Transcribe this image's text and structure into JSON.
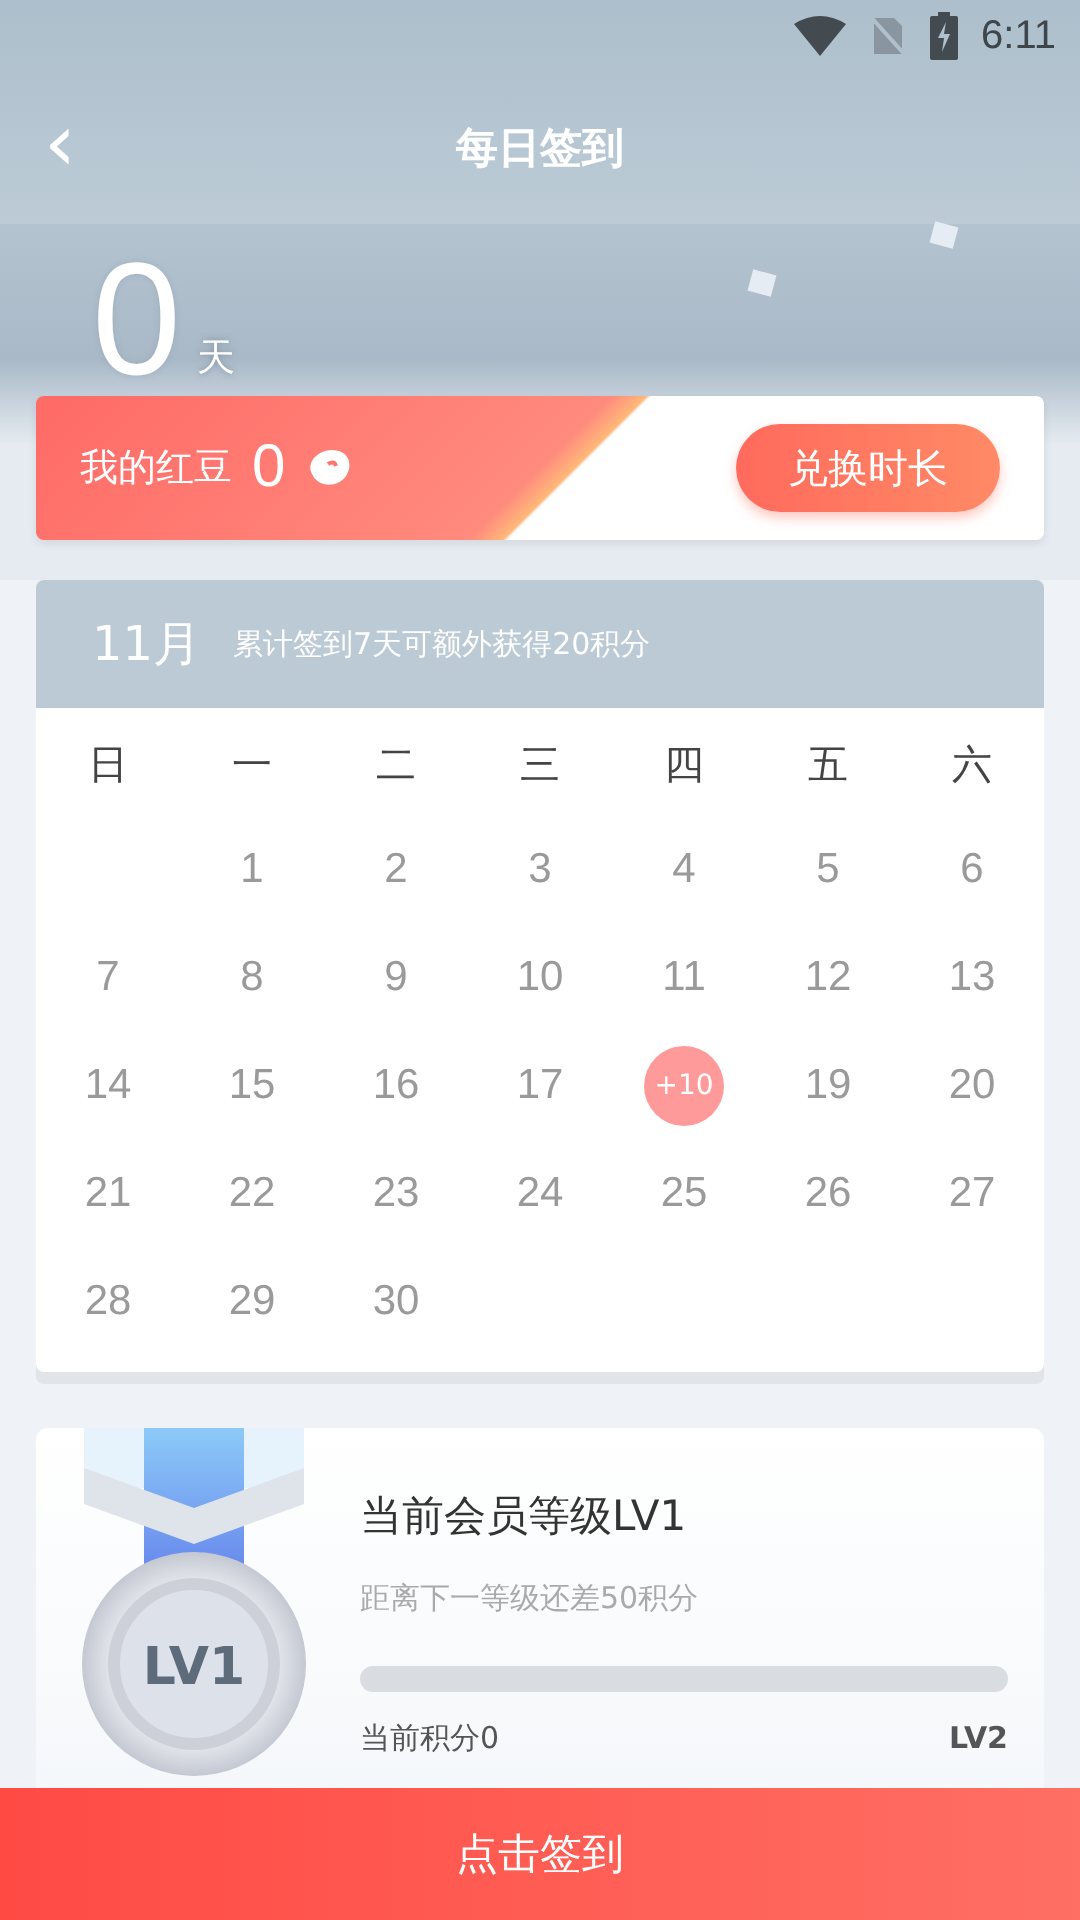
{
  "status_bar": {
    "time": "6:11"
  },
  "header": {
    "title": "每日签到",
    "back": "‹"
  },
  "streak": {
    "value": "0",
    "unit": "天"
  },
  "beans": {
    "label": "我的红豆",
    "count": "0",
    "button": "兑换时长"
  },
  "calendar": {
    "month": "11月",
    "note": "累计签到7天可额外获得20积分",
    "weekdays": [
      "日",
      "一",
      "二",
      "三",
      "四",
      "五",
      "六"
    ],
    "days": [
      {
        "kind": "empty"
      },
      {
        "kind": "day",
        "label": "1"
      },
      {
        "kind": "day",
        "label": "2"
      },
      {
        "kind": "day",
        "label": "3"
      },
      {
        "kind": "day",
        "label": "4"
      },
      {
        "kind": "day",
        "label": "5"
      },
      {
        "kind": "day",
        "label": "6"
      },
      {
        "kind": "day",
        "label": "7"
      },
      {
        "kind": "day",
        "label": "8"
      },
      {
        "kind": "day",
        "label": "9"
      },
      {
        "kind": "day",
        "label": "10"
      },
      {
        "kind": "day",
        "label": "11"
      },
      {
        "kind": "day",
        "label": "12"
      },
      {
        "kind": "day",
        "label": "13"
      },
      {
        "kind": "day",
        "label": "14"
      },
      {
        "kind": "day",
        "label": "15"
      },
      {
        "kind": "day",
        "label": "16"
      },
      {
        "kind": "day",
        "label": "17"
      },
      {
        "kind": "bonus",
        "label": "+10"
      },
      {
        "kind": "day",
        "label": "19"
      },
      {
        "kind": "day",
        "label": "20"
      },
      {
        "kind": "day",
        "label": "21"
      },
      {
        "kind": "day",
        "label": "22"
      },
      {
        "kind": "day",
        "label": "23"
      },
      {
        "kind": "day",
        "label": "24"
      },
      {
        "kind": "day",
        "label": "25"
      },
      {
        "kind": "day",
        "label": "26"
      },
      {
        "kind": "day",
        "label": "27"
      },
      {
        "kind": "day",
        "label": "28"
      },
      {
        "kind": "day",
        "label": "29"
      },
      {
        "kind": "day",
        "label": "30"
      }
    ]
  },
  "membership": {
    "medal": "LV1",
    "title": "当前会员等级LV1",
    "hint": "距离下一等级还差50积分",
    "level": 0,
    "points": "当前积分0",
    "next": "LV2"
  },
  "action": {
    "label": "点击签到"
  }
}
